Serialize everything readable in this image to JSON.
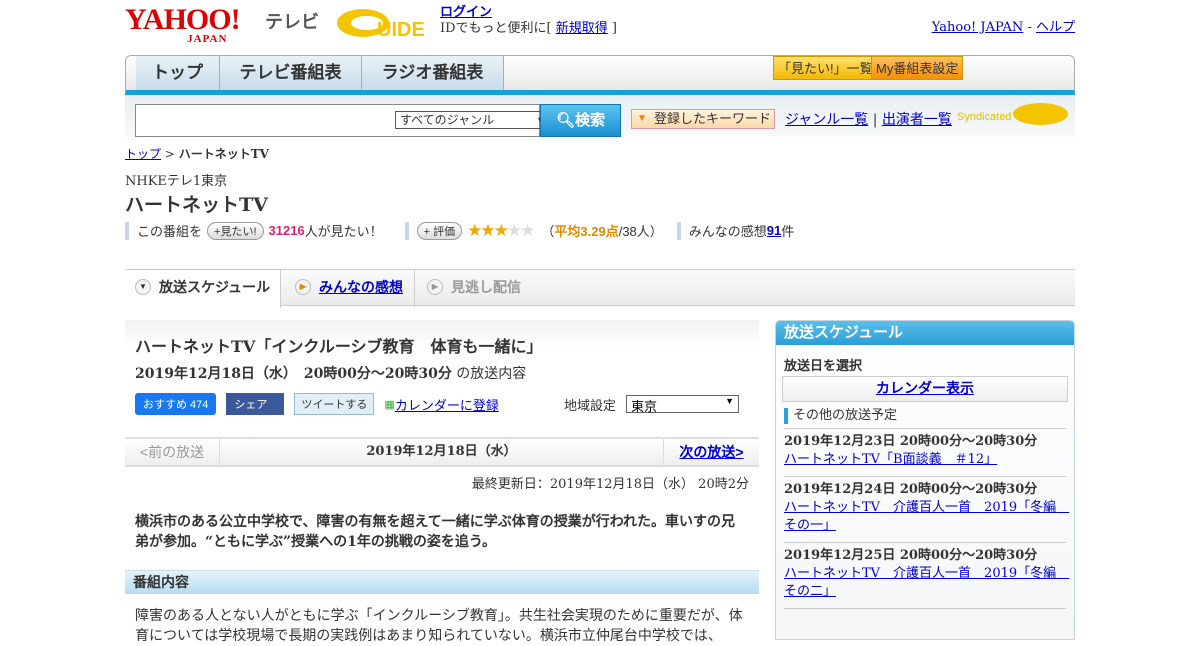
{
  "header": {
    "logo_yahoo": "YAHOO!",
    "logo_japan": "JAPAN",
    "logo_tv": "テレビ",
    "logo_gguide": "G-GUIDE",
    "login": "ログイン",
    "id_prompt_pre": "IDでもっと便利に[ ",
    "signup": "新規取得",
    "id_prompt_post": " ]",
    "yahoo_japan": "Yahoo! JAPAN",
    "dash": " - ",
    "help": "ヘルプ"
  },
  "nav": {
    "tabs": [
      "トップ",
      "テレビ番組表",
      "ラジオ番組表"
    ],
    "wishlist": "「見たい!」一覧",
    "my_settings": "My番組表設定"
  },
  "search": {
    "genre": "すべてのジャンル",
    "button": "検索",
    "keywords": "登録したキーワード",
    "genre_list": "ジャンル一覧",
    "cast_list": "出演者一覧",
    "syndicated": "Syndicated"
  },
  "breadcrumb": {
    "top": "トップ",
    "current": "ハートネットTV"
  },
  "program": {
    "channel": "NHKEテレ1東京",
    "title": "ハートネットTV",
    "this_program": "この番組を",
    "want_btn": "+見たい!",
    "want_count": "31216",
    "want_suffix": "人が見たい！",
    "rate_btn": "+ 評価",
    "rating": 3.29,
    "rating_text": "平均3.29点",
    "rating_count": "/38人）",
    "rating_open": "（",
    "reviews_label": "みんなの感想 ",
    "reviews_count": "91",
    "reviews_suffix": "件"
  },
  "tabs": [
    "放送スケジュール",
    "みんなの感想",
    "見逃し配信"
  ],
  "episode": {
    "title": "ハートネットTV「インクルーシブ教育　体育も一緒に」",
    "datetime": "2019年12月18日（水）　20時00分～20時30分",
    "datetime_suffix": " の放送内容",
    "fb": "おすすめ 474",
    "share": "シェア",
    "tweet": "ツイートする",
    "calendar": "カレンダーに登録",
    "region_label": "地域設定",
    "region": "東京",
    "prev": "<前の放送",
    "date": "2019年12月18日（水）",
    "next": "次の放送>",
    "updated": "最終更新日：2019年12月18日（水） 20時2分",
    "summary": "横浜市のある公立中学校で、障害の有無を超えて一緒に学ぶ体育の授業が行われた。車いすの兄弟が参加。“ともに学ぶ”授業への1年の挑戦の姿を追う。",
    "section": "番組内容",
    "body": "障害のある人とない人がともに学ぶ「インクルーシブ教育」。共生社会実現のために重要だが、体育については学校現場で長期の実践例はあまり知られていない。横浜市立仲尾台中学校では、"
  },
  "sidebar": {
    "title": "放送スケジュール",
    "select_date": "放送日を選択",
    "calendar": "カレンダー表示",
    "other": "その他の放送予定",
    "items": [
      {
        "time": "2019年12月23日 20時00分～20時30分",
        "title": "ハートネットTV「B面談義　＃12」"
      },
      {
        "time": "2019年12月24日 20時00分～20時30分",
        "title": "ハートネットTV　介護百人一首　2019「冬編　その一」"
      },
      {
        "time": "2019年12月25日 20時00分～20時30分",
        "title": "ハートネットTV　介護百人一首　2019「冬編　その二」"
      }
    ]
  }
}
